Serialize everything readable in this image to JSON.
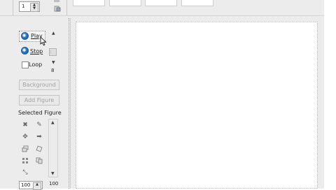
{
  "toolbar": {
    "frame_value": "1",
    "spin_up": "▲",
    "spin_down": "▼"
  },
  "animation": {
    "play_label": "Play",
    "stop_label": "Stop",
    "loop_label": "Loop",
    "speed_value": "8"
  },
  "buttons": {
    "background_label": "Background",
    "add_figure_label": "Add Figure"
  },
  "selected_figure": {
    "heading": "Selected Figure",
    "size_value": "100",
    "zoom_value": "100",
    "tools": [
      "delete-icon",
      "pencil-icon",
      "move-icon",
      "arrow-right-icon",
      "layers-icon",
      "rotate-icon",
      "grid-icon",
      "copy-icon",
      "wand-icon"
    ]
  },
  "colors": {
    "panel_bg": "#ececec",
    "radio_blue": "#2f74c2"
  }
}
